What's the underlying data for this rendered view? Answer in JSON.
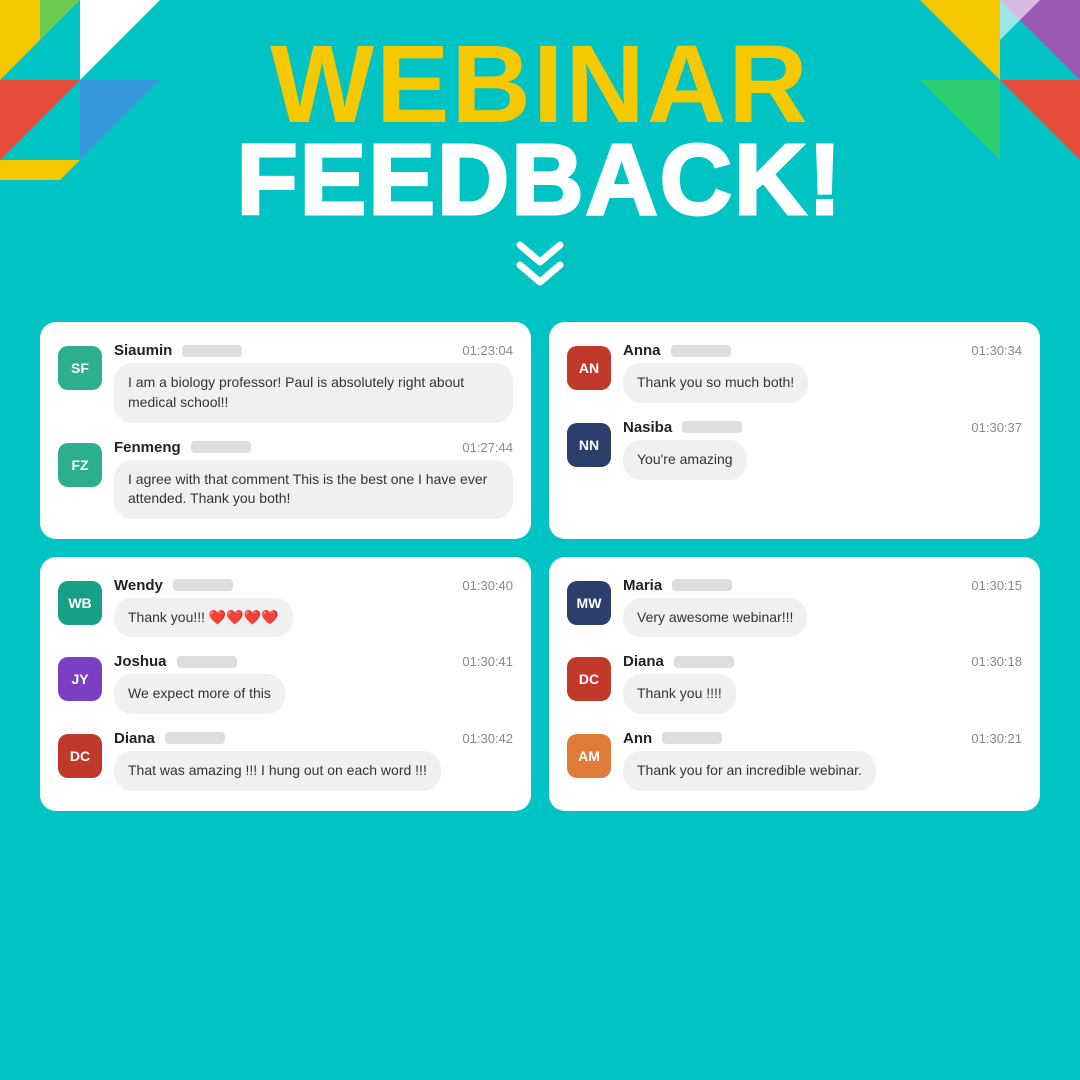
{
  "header": {
    "title_webinar": "WEBINAR",
    "title_feedback": "FEEDBACK!",
    "chevron": "❯❯"
  },
  "cards": [
    {
      "id": "card-top-left",
      "messages": [
        {
          "avatar_initials": "SF",
          "avatar_color": "av-teal",
          "sender": "Siaumin",
          "timestamp": "01:23:04",
          "text": "I am a biology professor! Paul is absolutely right about medical school!!"
        },
        {
          "avatar_initials": "FZ",
          "avatar_color": "av-green",
          "sender": "Fenmeng",
          "timestamp": "01:27:44",
          "text": "I agree with that comment This is the best one I have ever attended. Thank you both!"
        }
      ]
    },
    {
      "id": "card-top-right",
      "messages": [
        {
          "avatar_initials": "AN",
          "avatar_color": "av-red",
          "sender": "Anna",
          "timestamp": "01:30:34",
          "text": "Thank you so much both!"
        },
        {
          "avatar_initials": "NN",
          "avatar_color": "av-dark-navy",
          "sender": "Nasiba",
          "timestamp": "01:30:37",
          "text": "You're amazing"
        }
      ]
    },
    {
      "id": "card-bottom-left",
      "messages": [
        {
          "avatar_initials": "WB",
          "avatar_color": "av-teal2",
          "sender": "Wendy",
          "timestamp": "01:30:40",
          "text": "Thank you!!! ❤️❤️❤️❤️"
        },
        {
          "avatar_initials": "JY",
          "avatar_color": "av-purple",
          "sender": "Joshua",
          "timestamp": "01:30:41",
          "text": "We expect more of this"
        },
        {
          "avatar_initials": "DC",
          "avatar_color": "av-red",
          "sender": "Diana",
          "timestamp": "01:30:42",
          "text": "That was amazing !!! I hung out on each word !!!"
        }
      ]
    },
    {
      "id": "card-bottom-right",
      "messages": [
        {
          "avatar_initials": "MW",
          "avatar_color": "av-dark-navy",
          "sender": "Maria",
          "timestamp": "01:30:15",
          "text": "Very awesome webinar!!!"
        },
        {
          "avatar_initials": "DC",
          "avatar_color": "av-red",
          "sender": "Diana",
          "timestamp": "01:30:18",
          "text": "Thank you !!!!"
        },
        {
          "avatar_initials": "AM",
          "avatar_color": "av-orange",
          "sender": "Ann",
          "timestamp": "01:30:21",
          "text": "Thank you for an incredible webinar."
        }
      ]
    }
  ]
}
